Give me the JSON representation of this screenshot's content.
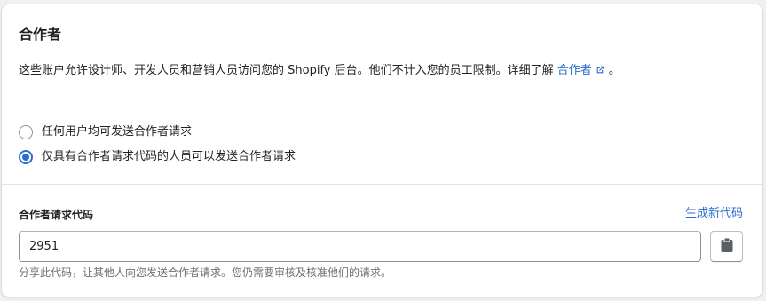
{
  "card": {
    "title": "合作者",
    "description_prefix": "这些账户允许设计师、开发人员和营销人员访问您的 Shopify 后台。他们不计入您的员工限制。详细了解",
    "description_link": "合作者",
    "description_suffix": "。",
    "link_icon": "external-link-icon"
  },
  "radio_options": [
    {
      "label": "任何用户均可发送合作者请求",
      "checked": false
    },
    {
      "label": "仅具有合作者请求代码的人员可以发送合作者请求",
      "checked": true
    }
  ],
  "code_section": {
    "label": "合作者请求代码",
    "generate_link": "生成新代码",
    "code_value": "2951",
    "copy_icon": "clipboard-icon",
    "help_text": "分享此代码，让其他人向您发送合作者请求。您仍需要审核及核准他们的请求。"
  },
  "colors": {
    "accent": "#2c6ecb",
    "text": "#202223",
    "subdued": "#6d7175",
    "border": "#e1e3e5"
  }
}
